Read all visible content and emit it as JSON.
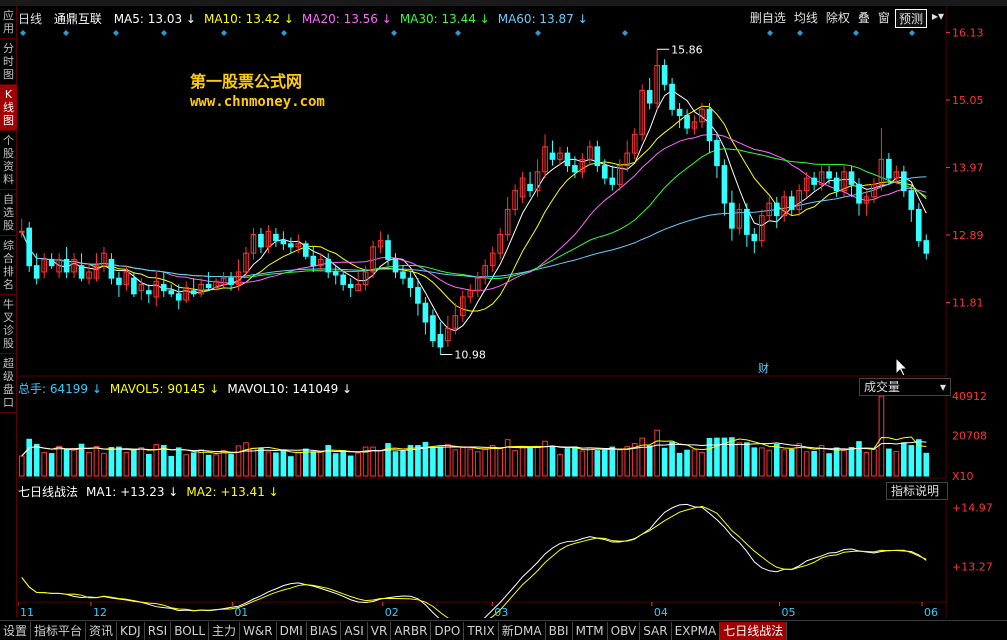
{
  "left_nav": [
    "应用",
    "分时图",
    "K线图",
    "个股资料",
    "自选股",
    "综合排名",
    "牛叉诊股",
    "超级盘口"
  ],
  "left_nav_active": 2,
  "header": {
    "period": "日线",
    "stock_name": "通鼎互联",
    "ma": [
      {
        "label": "MA5: 13.03",
        "color": "#ffffff"
      },
      {
        "label": "MA10: 13.42",
        "color": "#ffff00"
      },
      {
        "label": "MA20: 13.56",
        "color": "#ff66ff"
      },
      {
        "label": "MA30: 13.44",
        "color": "#33ff33"
      },
      {
        "label": "MA60: 13.87",
        "color": "#66ccff"
      }
    ]
  },
  "toolbar": [
    "删自选",
    "均线",
    "除权",
    "叠",
    "窗",
    "预测"
  ],
  "watermark": {
    "title": "第一股票公式网",
    "url": "www.chnmoney.com"
  },
  "price_axis": [
    "16.13",
    "15.05",
    "13.97",
    "12.89",
    "11.81"
  ],
  "price_annotations": {
    "high": "15.86",
    "low": "10.98",
    "fin": "财"
  },
  "volume_header": {
    "items": [
      {
        "label": "总手: 64199",
        "color": "#33ccff"
      },
      {
        "label": "MAVOL5: 90145",
        "color": "#ffff00"
      },
      {
        "label": "MAVOL10: 141049",
        "color": "#ffffff"
      }
    ],
    "selector": "成交量"
  },
  "volume_axis": [
    "40912",
    "20708",
    "X10"
  ],
  "indicator_header": {
    "items": [
      {
        "label": "七日线战法",
        "color": "#ffffff"
      },
      {
        "label": "MA1: +13.23",
        "color": "#ffffff"
      },
      {
        "label": "MA2: +13.41",
        "color": "#ffff00"
      }
    ],
    "button": "指标说明"
  },
  "indicator_axis": [
    "+14.97",
    "+13.27"
  ],
  "date_axis": [
    {
      "label": "11",
      "pos": 0.0
    },
    {
      "label": "12",
      "pos": 0.08
    },
    {
      "label": "01",
      "pos": 0.235
    },
    {
      "label": "02",
      "pos": 0.4
    },
    {
      "label": "03",
      "pos": 0.52
    },
    {
      "label": "04",
      "pos": 0.695
    },
    {
      "label": "05",
      "pos": 0.835
    },
    {
      "label": "06",
      "pos": 0.995
    }
  ],
  "bottom_tabs": [
    "设置",
    "指标平台",
    "资讯",
    "KDJ",
    "RSI",
    "BOLL",
    "主力",
    "W&R",
    "DMI",
    "BIAS",
    "ASI",
    "VR",
    "ARBR",
    "DPO",
    "TRIX",
    "新DMA",
    "BBI",
    "MTM",
    "OBV",
    "SAR",
    "EXPMA",
    "七日线战法"
  ],
  "bottom_tabs_active": 21,
  "colors": {
    "up": "#ff3333",
    "down": "#33ffff",
    "grid": "#5a0000",
    "axis_text": "#ff3333"
  },
  "chart_data": {
    "type": "candlestick",
    "price_range": [
      10.7,
      16.2
    ],
    "candles": [
      [
        12.95,
        12.95,
        13.15,
        12.85
      ],
      [
        13.0,
        12.4,
        13.1,
        12.3
      ],
      [
        12.4,
        12.2,
        12.6,
        12.1
      ],
      [
        12.3,
        12.5,
        12.6,
        12.2
      ],
      [
        12.5,
        12.4,
        12.6,
        12.35
      ],
      [
        12.3,
        12.5,
        12.6,
        12.2
      ],
      [
        12.5,
        12.3,
        12.7,
        12.2
      ],
      [
        12.3,
        12.5,
        12.6,
        12.2
      ],
      [
        12.4,
        12.2,
        12.6,
        12.15
      ],
      [
        12.2,
        12.3,
        12.45,
        12.1
      ],
      [
        12.2,
        12.4,
        12.6,
        12.15
      ],
      [
        12.4,
        12.6,
        12.7,
        12.3
      ],
      [
        12.5,
        12.2,
        12.6,
        12.1
      ],
      [
        12.2,
        12.1,
        12.3,
        11.9
      ],
      [
        12.1,
        12.3,
        12.4,
        12.0
      ],
      [
        12.2,
        11.95,
        12.3,
        11.9
      ],
      [
        12.0,
        12.1,
        12.2,
        11.85
      ],
      [
        12.0,
        11.95,
        12.1,
        11.8
      ],
      [
        11.9,
        12.15,
        12.3,
        11.75
      ],
      [
        12.1,
        12.0,
        12.3,
        11.9
      ],
      [
        12.0,
        11.95,
        12.1,
        11.9
      ],
      [
        11.95,
        11.85,
        12.1,
        11.7
      ],
      [
        11.85,
        12.05,
        12.15,
        11.8
      ],
      [
        12.0,
        11.95,
        12.2,
        11.9
      ],
      [
        11.95,
        12.1,
        12.2,
        11.9
      ],
      [
        12.1,
        12.05,
        12.3,
        12.0
      ],
      [
        12.05,
        12.15,
        12.2,
        12.0
      ],
      [
        12.1,
        12.2,
        12.3,
        12.05
      ],
      [
        12.2,
        12.1,
        12.3,
        12.0
      ],
      [
        12.1,
        12.3,
        12.5,
        12.0
      ],
      [
        12.3,
        12.6,
        12.7,
        12.2
      ],
      [
        12.6,
        12.9,
        13.0,
        12.5
      ],
      [
        12.9,
        12.7,
        13.0,
        12.6
      ],
      [
        12.7,
        12.95,
        13.05,
        12.6
      ],
      [
        12.9,
        12.8,
        13.0,
        12.7
      ],
      [
        12.8,
        12.75,
        12.95,
        12.65
      ],
      [
        12.75,
        12.7,
        12.85,
        12.6
      ],
      [
        12.7,
        12.75,
        12.9,
        12.6
      ],
      [
        12.75,
        12.55,
        12.8,
        12.5
      ],
      [
        12.55,
        12.4,
        12.7,
        12.3
      ],
      [
        12.4,
        12.5,
        12.6,
        12.3
      ],
      [
        12.5,
        12.3,
        12.6,
        12.2
      ],
      [
        12.3,
        12.25,
        12.4,
        12.1
      ],
      [
        12.25,
        12.1,
        12.3,
        12.0
      ],
      [
        12.1,
        12.05,
        12.2,
        11.9
      ],
      [
        12.0,
        12.1,
        12.3,
        12.0
      ],
      [
        12.1,
        12.3,
        12.4,
        12.0
      ],
      [
        12.3,
        12.7,
        12.8,
        12.2
      ],
      [
        12.7,
        12.8,
        12.95,
        12.6
      ],
      [
        12.8,
        12.5,
        12.9,
        12.4
      ],
      [
        12.5,
        12.3,
        12.6,
        12.2
      ],
      [
        12.3,
        12.2,
        12.4,
        12.1
      ],
      [
        12.2,
        12.05,
        12.3,
        11.9
      ],
      [
        12.05,
        11.8,
        12.2,
        11.6
      ],
      [
        11.8,
        11.5,
        11.9,
        11.3
      ],
      [
        11.6,
        11.2,
        11.7,
        11.1
      ],
      [
        11.3,
        11.1,
        11.5,
        10.98
      ],
      [
        11.2,
        11.4,
        11.6,
        11.1
      ],
      [
        11.4,
        11.6,
        11.8,
        11.3
      ],
      [
        11.6,
        11.9,
        12.0,
        11.5
      ],
      [
        11.9,
        12.0,
        12.1,
        11.8
      ],
      [
        12.0,
        12.2,
        12.3,
        11.9
      ],
      [
        12.2,
        12.4,
        12.5,
        12.1
      ],
      [
        12.4,
        12.6,
        12.7,
        12.3
      ],
      [
        12.6,
        12.9,
        13.0,
        12.5
      ],
      [
        12.9,
        13.3,
        13.5,
        12.8
      ],
      [
        13.3,
        13.6,
        13.7,
        13.2
      ],
      [
        13.5,
        13.8,
        13.9,
        13.4
      ],
      [
        13.7,
        13.6,
        13.9,
        13.5
      ],
      [
        13.6,
        13.9,
        14.1,
        13.5
      ],
      [
        13.9,
        14.3,
        14.5,
        13.8
      ],
      [
        14.2,
        14.1,
        14.4,
        14.0
      ],
      [
        14.1,
        14.2,
        14.3,
        14.0
      ],
      [
        14.2,
        14.0,
        14.3,
        13.9
      ],
      [
        14.0,
        13.9,
        14.15,
        13.8
      ],
      [
        13.9,
        14.1,
        14.2,
        13.8
      ],
      [
        14.1,
        14.3,
        14.4,
        14.0
      ],
      [
        14.3,
        14.0,
        14.4,
        13.9
      ],
      [
        14.0,
        13.8,
        14.1,
        13.7
      ],
      [
        13.8,
        13.7,
        14.0,
        13.6
      ],
      [
        13.7,
        14.0,
        14.1,
        13.6
      ],
      [
        14.0,
        14.2,
        14.4,
        13.9
      ],
      [
        14.2,
        14.5,
        14.6,
        14.1
      ],
      [
        14.5,
        15.2,
        15.3,
        14.4
      ],
      [
        15.2,
        15.0,
        15.4,
        14.9
      ],
      [
        15.0,
        15.6,
        15.86,
        14.9
      ],
      [
        15.6,
        15.3,
        15.7,
        15.2
      ],
      [
        15.3,
        14.9,
        15.4,
        14.8
      ],
      [
        14.9,
        14.8,
        15.0,
        14.6
      ],
      [
        14.8,
        14.6,
        14.9,
        14.5
      ],
      [
        14.6,
        14.7,
        14.8,
        14.5
      ],
      [
        14.7,
        14.9,
        15.0,
        14.6
      ],
      [
        14.9,
        14.4,
        15.0,
        14.2
      ],
      [
        14.4,
        14.0,
        14.5,
        13.8
      ],
      [
        14.0,
        13.4,
        14.1,
        13.2
      ],
      [
        13.4,
        13.0,
        13.6,
        12.8
      ],
      [
        13.0,
        13.3,
        13.4,
        12.9
      ],
      [
        13.3,
        12.9,
        13.4,
        12.7
      ],
      [
        12.9,
        12.8,
        13.0,
        12.6
      ],
      [
        12.8,
        13.2,
        13.3,
        12.7
      ],
      [
        13.2,
        13.4,
        13.5,
        13.1
      ],
      [
        13.4,
        13.2,
        13.5,
        13.0
      ],
      [
        13.2,
        13.5,
        13.6,
        13.1
      ],
      [
        13.5,
        13.3,
        13.6,
        13.2
      ],
      [
        13.3,
        13.6,
        13.7,
        13.2
      ],
      [
        13.6,
        13.8,
        13.9,
        13.5
      ],
      [
        13.8,
        13.7,
        13.9,
        13.6
      ],
      [
        13.7,
        13.9,
        14.0,
        13.6
      ],
      [
        13.9,
        13.8,
        14.0,
        13.7
      ],
      [
        13.8,
        13.6,
        13.9,
        13.5
      ],
      [
        13.6,
        13.9,
        14.0,
        13.5
      ],
      [
        13.9,
        13.7,
        14.0,
        13.5
      ],
      [
        13.7,
        13.4,
        13.8,
        13.2
      ],
      [
        13.4,
        13.5,
        13.6,
        13.2
      ],
      [
        13.5,
        13.7,
        13.8,
        13.4
      ],
      [
        13.7,
        14.1,
        14.6,
        13.6
      ],
      [
        14.1,
        13.8,
        14.2,
        13.7
      ],
      [
        13.8,
        13.9,
        14.0,
        13.7
      ],
      [
        13.9,
        13.6,
        14.0,
        13.5
      ],
      [
        13.6,
        13.3,
        13.7,
        13.1
      ],
      [
        13.3,
        12.8,
        13.4,
        12.7
      ],
      [
        12.8,
        12.6,
        12.9,
        12.5
      ]
    ],
    "volume_range": [
      0,
      42000
    ],
    "volume_scale_note": "X10",
    "indicator_range": [
      12.3,
      15.3
    ]
  }
}
